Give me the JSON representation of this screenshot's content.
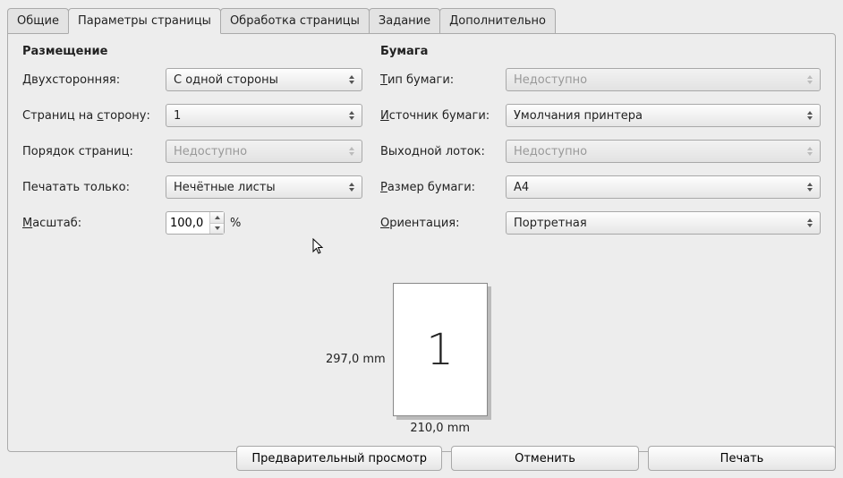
{
  "tabs": {
    "general": "Общие",
    "page_params": "Параметры страницы",
    "page_processing": "Обработка страницы",
    "job": "Задание",
    "advanced": "Дополнительно",
    "active": "page_params"
  },
  "layout": {
    "title": "Размещение",
    "duplex_label": "Двухсторонняя:",
    "duplex_value": "С одной стороны",
    "pps_label_pre": "Страниц на ",
    "pps_label_u": "с",
    "pps_label_post": "торону:",
    "pps_value": "1",
    "order_label": "Порядок страниц:",
    "order_value": "Недоступно",
    "only_label": "Печатать только:",
    "only_value": "Нечётные листы",
    "scale_label_u": "М",
    "scale_label_post": "асштаб:",
    "scale_value": "100,0",
    "scale_unit": "%"
  },
  "paper": {
    "title": "Бумага",
    "type_label_u": "Т",
    "type_label_post": "ип бумаги:",
    "type_value": "Недоступно",
    "source_label_u": "И",
    "source_label_post": "сточник бумаги:",
    "source_value": "Умолчания принтера",
    "tray_label": "Выходной лоток:",
    "tray_value": "Недоступно",
    "size_label_u": "Р",
    "size_label_post": "азмер бумаги:",
    "size_value": "A4",
    "orient_label_u": "О",
    "orient_label_post": "риентация:",
    "orient_value": "Портретная"
  },
  "preview": {
    "height": "297,0 mm",
    "width": "210,0 mm",
    "page_number": "1"
  },
  "buttons": {
    "preview": "Предварительный просмотр",
    "cancel": "Отменить",
    "print": "Печать"
  }
}
